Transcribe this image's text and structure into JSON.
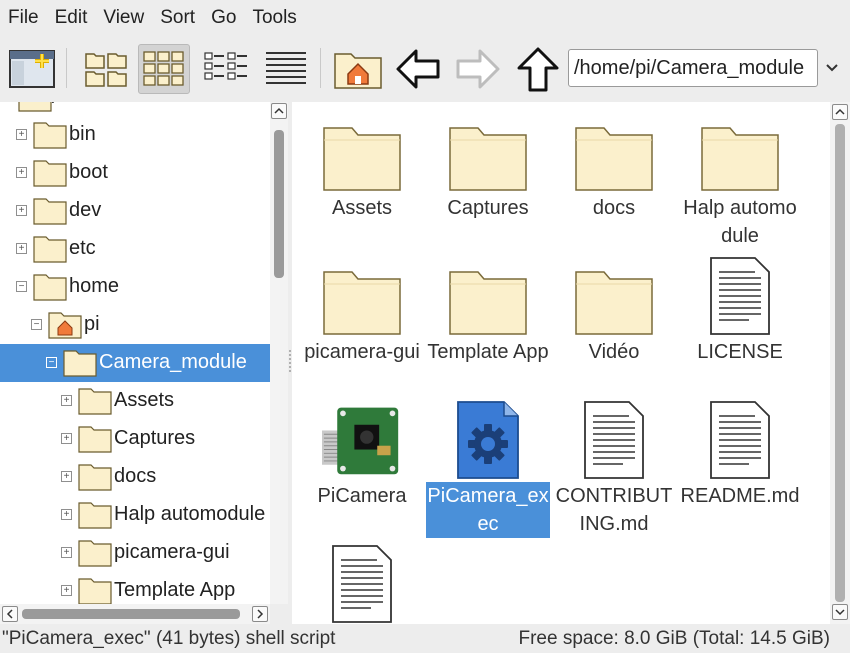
{
  "menu": [
    "File",
    "Edit",
    "View",
    "Sort",
    "Go",
    "Tools"
  ],
  "toolbar": {
    "buttons": [
      "new-window",
      "icon-view",
      "thumbnail-view",
      "compact-view",
      "detailed-list-view",
      "home",
      "back",
      "forward",
      "up"
    ],
    "active": "thumbnail-view",
    "path": "/home/pi/Camera_module"
  },
  "tree": {
    "items": [
      {
        "label": "bin"
      },
      {
        "label": "boot"
      },
      {
        "label": "dev"
      },
      {
        "label": "etc"
      },
      {
        "label": "home"
      },
      {
        "label": "pi"
      },
      {
        "label": "Camera_module"
      },
      {
        "label": "Assets"
      },
      {
        "label": "Captures"
      },
      {
        "label": "docs"
      },
      {
        "label": "Halp automodule"
      },
      {
        "label": "picamera-gui"
      },
      {
        "label": "Template App"
      }
    ],
    "selected": "Camera_module"
  },
  "files": {
    "items": [
      {
        "label": "Assets",
        "icon": "folder-icon"
      },
      {
        "label": "Captures",
        "icon": "folder-icon"
      },
      {
        "label": "docs",
        "icon": "folder-icon"
      },
      {
        "label": "Halp automodule",
        "icon": "folder-icon"
      },
      {
        "label": "picamera-gui",
        "icon": "folder-icon"
      },
      {
        "label": "Template App",
        "icon": "folder-icon"
      },
      {
        "label": "Vidéo",
        "icon": "folder-icon"
      },
      {
        "label": "LICENSE",
        "icon": "text-file-icon"
      },
      {
        "label": "PiCamera",
        "icon": "camera-board-image-icon"
      },
      {
        "label": "PiCamera_exec",
        "icon": "executable-gear-icon"
      },
      {
        "label": "CONTRIBUTING.md",
        "icon": "text-file-icon"
      },
      {
        "label": "README.md",
        "icon": "text-file-icon"
      },
      {
        "label": "",
        "icon": "text-file-icon"
      }
    ],
    "selected": "PiCamera_exec"
  },
  "status": {
    "left": "\"PiCamera_exec\" (41 bytes) shell script",
    "right": "Free space: 8.0 GiB (Total: 14.5 GiB)"
  },
  "colors": {
    "selection": "#4a90d9",
    "folder_fill": "#fbf0cc",
    "folder_stroke": "#7a6a3a",
    "background": "#ededed"
  }
}
